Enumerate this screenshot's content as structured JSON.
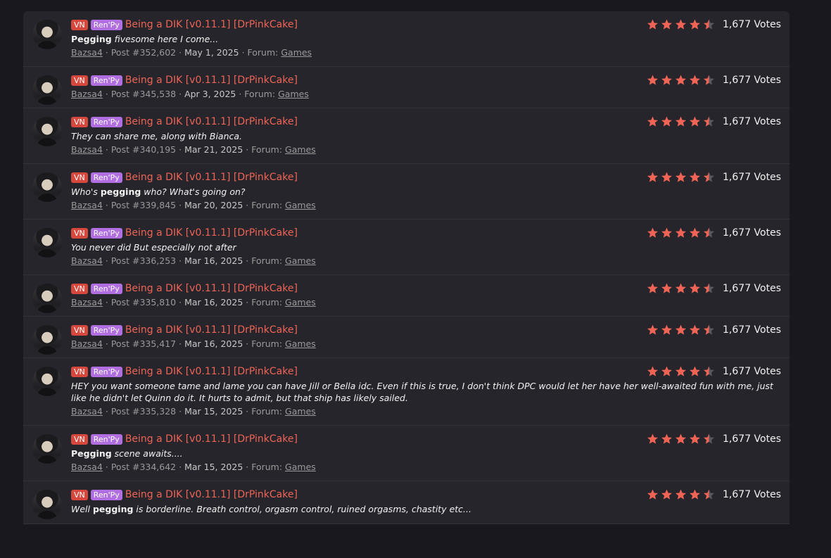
{
  "colors": {
    "page_bg": "#19181e",
    "card_bg": "#26252b",
    "title": "#f06456",
    "vn_badge": "#d6473d",
    "renpy_badge": "#b06ee0",
    "star": "#f06456",
    "star_empty": "#5a5960"
  },
  "common": {
    "badge_vn": "VN",
    "badge_renpy": "Ren'Py",
    "title": "Being a DIK [v0.11.1] [DrPinkCake]",
    "votes": "1,677 Votes",
    "rating_stars": 4.5,
    "author": "Bazsa4",
    "forum_label": "Forum:",
    "forum": "Games",
    "sep": "·",
    "avatar_icon": "user-avatar-icon"
  },
  "results": [
    {
      "snippet": [
        {
          "t": "Pegging",
          "b": true
        },
        {
          "t": " fivesome here I come..."
        }
      ],
      "post": "Post #352,602",
      "date": "May 1, 2025"
    },
    {
      "snippet": [],
      "post": "Post #345,538",
      "date": "Apr 3, 2025"
    },
    {
      "snippet": [
        {
          "t": "They can share me, along with Bianca."
        }
      ],
      "post": "Post #340,195",
      "date": "Mar 21, 2025"
    },
    {
      "snippet": [
        {
          "t": "Who's "
        },
        {
          "t": "pegging",
          "b": true
        },
        {
          "t": " who? What's going on?"
        }
      ],
      "post": "Post #339,845",
      "date": "Mar 20, 2025"
    },
    {
      "snippet": [
        {
          "t": "You never did But especially not after"
        }
      ],
      "post": "Post #336,253",
      "date": "Mar 16, 2025"
    },
    {
      "snippet": [],
      "post": "Post #335,810",
      "date": "Mar 16, 2025"
    },
    {
      "snippet": [],
      "post": "Post #335,417",
      "date": "Mar 16, 2025"
    },
    {
      "snippet": [
        {
          "t": "HEY you want someone tame and lame you can have Jill or Bella idc. Even if this is true, I don't think DPC would let her have her well-awaited fun with me, just like he didn't let Quinn do it. It hurts to admit, but that ship has likely sailed."
        }
      ],
      "post": "Post #335,328",
      "date": "Mar 15, 2025"
    },
    {
      "snippet": [
        {
          "t": "Pegging",
          "b": true
        },
        {
          "t": " scene awaits...."
        }
      ],
      "post": "Post #334,642",
      "date": "Mar 15, 2025"
    },
    {
      "snippet": [
        {
          "t": "Well "
        },
        {
          "t": "pegging",
          "b": true
        },
        {
          "t": " is borderline. Breath control, orgasm control, ruined orgasms, chastity etc..."
        }
      ],
      "post": "",
      "date": ""
    }
  ]
}
